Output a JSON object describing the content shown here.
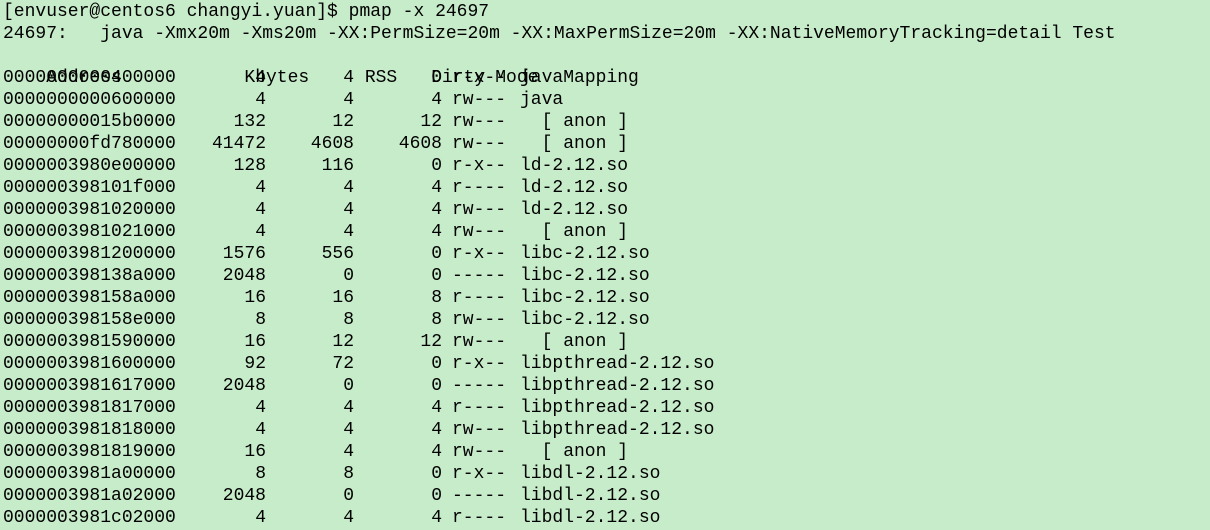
{
  "terminal": {
    "prompt_line": "[envuser@centos6 changyi.yuan]$ pmap -x 24697",
    "process_line": "24697:   java -Xmx20m -Xms20m -XX:PermSize=20m -XX:MaxPermSize=20m -XX:NativeMemoryTracking=detail Test",
    "background_color": "#c7ecc9",
    "text_color": "#000000"
  },
  "table": {
    "headers": {
      "address": "Address",
      "kbytes": "Kbytes",
      "rss": "RSS",
      "dirty": "Dirty",
      "mode": "Mode",
      "mapping": "Mapping"
    },
    "rows": [
      {
        "address": "0000000000400000",
        "kbytes": "4",
        "rss": "4",
        "dirty": "0",
        "mode": "r-x--",
        "mapping": "java"
      },
      {
        "address": "0000000000600000",
        "kbytes": "4",
        "rss": "4",
        "dirty": "4",
        "mode": "rw---",
        "mapping": "java"
      },
      {
        "address": "00000000015b0000",
        "kbytes": "132",
        "rss": "12",
        "dirty": "12",
        "mode": "rw---",
        "mapping": "  [ anon ]"
      },
      {
        "address": "00000000fd780000",
        "kbytes": "41472",
        "rss": "4608",
        "dirty": "4608",
        "mode": "rw---",
        "mapping": "  [ anon ]"
      },
      {
        "address": "0000003980e00000",
        "kbytes": "128",
        "rss": "116",
        "dirty": "0",
        "mode": "r-x--",
        "mapping": "ld-2.12.so"
      },
      {
        "address": "000000398101f000",
        "kbytes": "4",
        "rss": "4",
        "dirty": "4",
        "mode": "r----",
        "mapping": "ld-2.12.so"
      },
      {
        "address": "0000003981020000",
        "kbytes": "4",
        "rss": "4",
        "dirty": "4",
        "mode": "rw---",
        "mapping": "ld-2.12.so"
      },
      {
        "address": "0000003981021000",
        "kbytes": "4",
        "rss": "4",
        "dirty": "4",
        "mode": "rw---",
        "mapping": "  [ anon ]"
      },
      {
        "address": "0000003981200000",
        "kbytes": "1576",
        "rss": "556",
        "dirty": "0",
        "mode": "r-x--",
        "mapping": "libc-2.12.so"
      },
      {
        "address": "000000398138a000",
        "kbytes": "2048",
        "rss": "0",
        "dirty": "0",
        "mode": "-----",
        "mapping": "libc-2.12.so"
      },
      {
        "address": "000000398158a000",
        "kbytes": "16",
        "rss": "16",
        "dirty": "8",
        "mode": "r----",
        "mapping": "libc-2.12.so"
      },
      {
        "address": "000000398158e000",
        "kbytes": "8",
        "rss": "8",
        "dirty": "8",
        "mode": "rw---",
        "mapping": "libc-2.12.so"
      },
      {
        "address": "0000003981590000",
        "kbytes": "16",
        "rss": "12",
        "dirty": "12",
        "mode": "rw---",
        "mapping": "  [ anon ]"
      },
      {
        "address": "0000003981600000",
        "kbytes": "92",
        "rss": "72",
        "dirty": "0",
        "mode": "r-x--",
        "mapping": "libpthread-2.12.so"
      },
      {
        "address": "0000003981617000",
        "kbytes": "2048",
        "rss": "0",
        "dirty": "0",
        "mode": "-----",
        "mapping": "libpthread-2.12.so"
      },
      {
        "address": "0000003981817000",
        "kbytes": "4",
        "rss": "4",
        "dirty": "4",
        "mode": "r----",
        "mapping": "libpthread-2.12.so"
      },
      {
        "address": "0000003981818000",
        "kbytes": "4",
        "rss": "4",
        "dirty": "4",
        "mode": "rw---",
        "mapping": "libpthread-2.12.so"
      },
      {
        "address": "0000003981819000",
        "kbytes": "16",
        "rss": "4",
        "dirty": "4",
        "mode": "rw---",
        "mapping": "  [ anon ]"
      },
      {
        "address": "0000003981a00000",
        "kbytes": "8",
        "rss": "8",
        "dirty": "0",
        "mode": "r-x--",
        "mapping": "libdl-2.12.so"
      },
      {
        "address": "0000003981a02000",
        "kbytes": "2048",
        "rss": "0",
        "dirty": "0",
        "mode": "-----",
        "mapping": "libdl-2.12.so"
      },
      {
        "address": "0000003981c02000",
        "kbytes": "4",
        "rss": "4",
        "dirty": "4",
        "mode": "r----",
        "mapping": "libdl-2.12.so"
      }
    ]
  }
}
